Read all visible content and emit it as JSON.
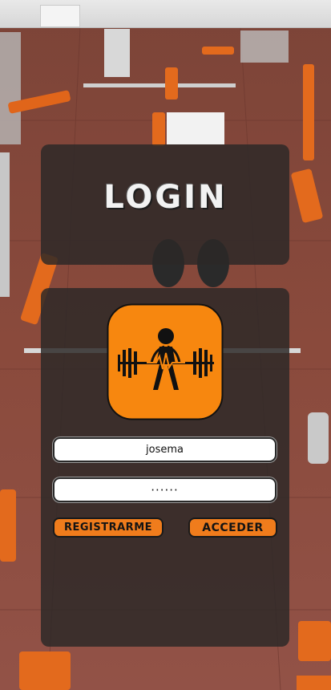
{
  "login": {
    "title": "LOGIN",
    "logo_icon": "weightlifter-heartbeat-icon",
    "colors": {
      "accent": "#f7870f",
      "card": "#2c2827",
      "button": "#f07c1c"
    }
  },
  "form": {
    "username_value": "josema",
    "password_value": "······",
    "register_label": "REGISTRARME",
    "submit_label": "ACCEDER"
  }
}
